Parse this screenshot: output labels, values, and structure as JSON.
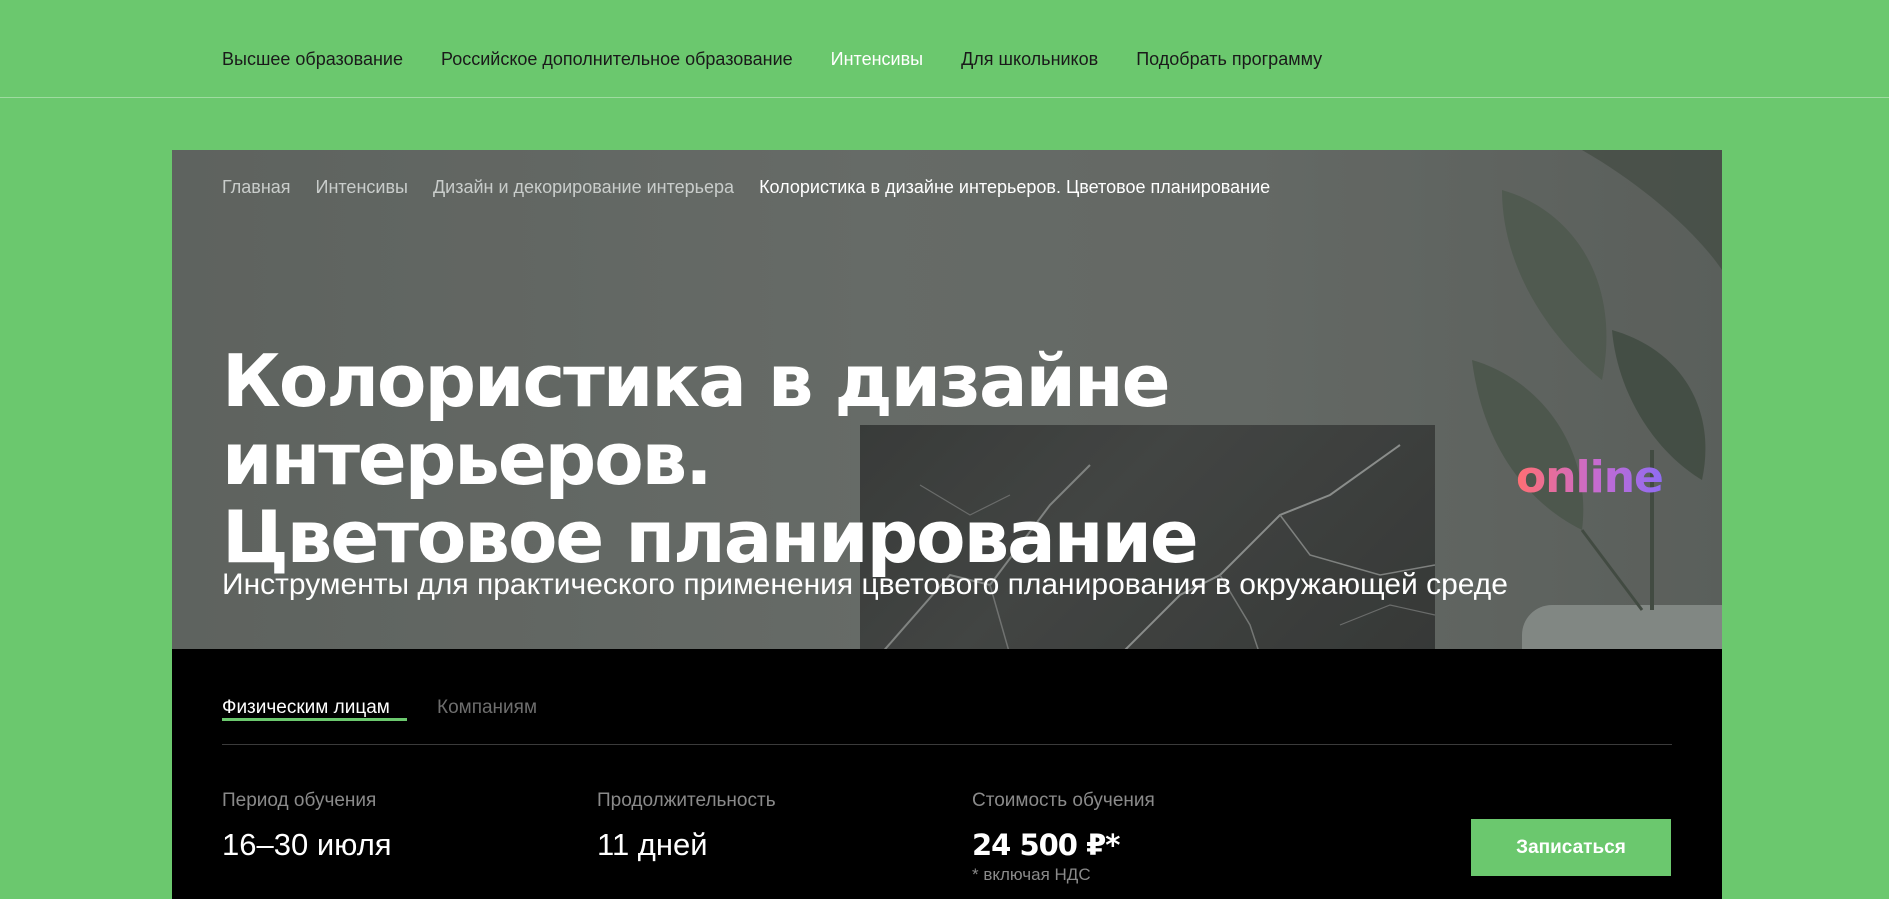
{
  "nav": {
    "items": [
      {
        "label": "Высшее образование"
      },
      {
        "label": "Российское дополнительное образование"
      },
      {
        "label": "Интенсивы"
      },
      {
        "label": "Для школьников"
      },
      {
        "label": "Подобрать программу"
      }
    ],
    "active_item": "Интенсивы"
  },
  "breadcrumb": [
    {
      "label": "Главная"
    },
    {
      "label": "Интенсивы"
    },
    {
      "label": "Дизайн и декорирование интерьера"
    },
    {
      "label": "Колористика в дизайне интерьеров. Цветовое планирование"
    }
  ],
  "hero": {
    "title_line1": "Колористика в дизайне интерьеров.",
    "title_line2": "Цветовое планирование",
    "format_badge": "online",
    "subtitle": "Инструменты для практического применения цветового планирования в окружающей среде"
  },
  "tabs": [
    {
      "label": "Физическим лицам"
    },
    {
      "label": "Компаниям"
    }
  ],
  "active_tab": "Физическим лицам",
  "info": {
    "period_label": "Период обучения",
    "period_value": "16–30 июля",
    "duration_label": "Продолжительность",
    "duration_value": "11 дней",
    "cost_label": "Стоимость обучения",
    "cost_value": "24 500 ₽*",
    "cost_note": "* включая НДС"
  },
  "signup_button": "Записаться",
  "colors": {
    "page_background": "#6bc86e",
    "accent": "#6bc86e",
    "panel_background": "#000000"
  }
}
